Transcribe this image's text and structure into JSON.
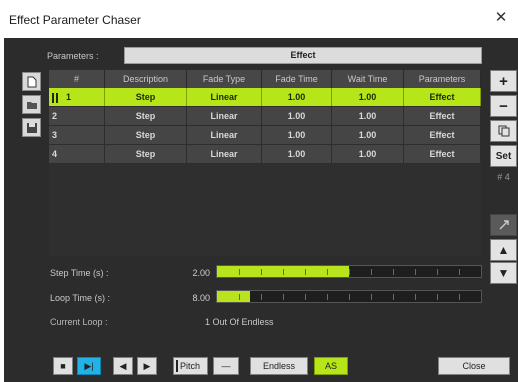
{
  "window": {
    "title": "Effect Parameter Chaser",
    "close_glyph": "✕"
  },
  "parameters": {
    "label": "Parameters :",
    "value": "Effect"
  },
  "sidebar": {
    "left": [
      {
        "icon": "new-document-icon"
      },
      {
        "icon": "open-folder-icon"
      },
      {
        "icon": "save-disk-icon"
      }
    ],
    "right": {
      "add_label": "+",
      "remove_label": "−",
      "copy_icon": "copy-icon",
      "set_label": "Set",
      "set_count": "# 4",
      "up_label": "▲",
      "down_label": "▼"
    }
  },
  "table": {
    "columns": [
      "#",
      "Description",
      "Fade Type",
      "Fade Time",
      "Wait Time",
      "Parameters"
    ],
    "rows": [
      {
        "num": "1",
        "description": "Step",
        "fade_type": "Linear",
        "fade_time": "1.00",
        "wait_time": "1.00",
        "parameters": "Effect"
      },
      {
        "num": "2",
        "description": "Step",
        "fade_type": "Linear",
        "fade_time": "1.00",
        "wait_time": "1.00",
        "parameters": "Effect"
      },
      {
        "num": "3",
        "description": "Step",
        "fade_type": "Linear",
        "fade_time": "1.00",
        "wait_time": "1.00",
        "parameters": "Effect"
      },
      {
        "num": "4",
        "description": "Step",
        "fade_type": "Linear",
        "fade_time": "1.00",
        "wait_time": "1.00",
        "parameters": "Effect"
      }
    ]
  },
  "step_time": {
    "label": "Step Time (s) :",
    "value": "2.00",
    "fill_fraction": 0.5
  },
  "loop_time": {
    "label": "Loop Time (s) :",
    "value": "8.00",
    "fill_fraction": 0.125
  },
  "current_loop": {
    "label": "Current Loop :",
    "value": "1  Out Of Endless"
  },
  "transport": {
    "stop_glyph": "■",
    "play_glyph": "▶|",
    "prev_glyph": "◀",
    "next_glyph": "▶",
    "pitch_label": "Pitch",
    "dash_label": "—",
    "endless_label": "Endless",
    "as_label": "AS",
    "close_label": "Close"
  },
  "colors": {
    "accent": "#b6e51a",
    "play_blue": "#23b2e6",
    "panel": "#2c2c2c"
  }
}
